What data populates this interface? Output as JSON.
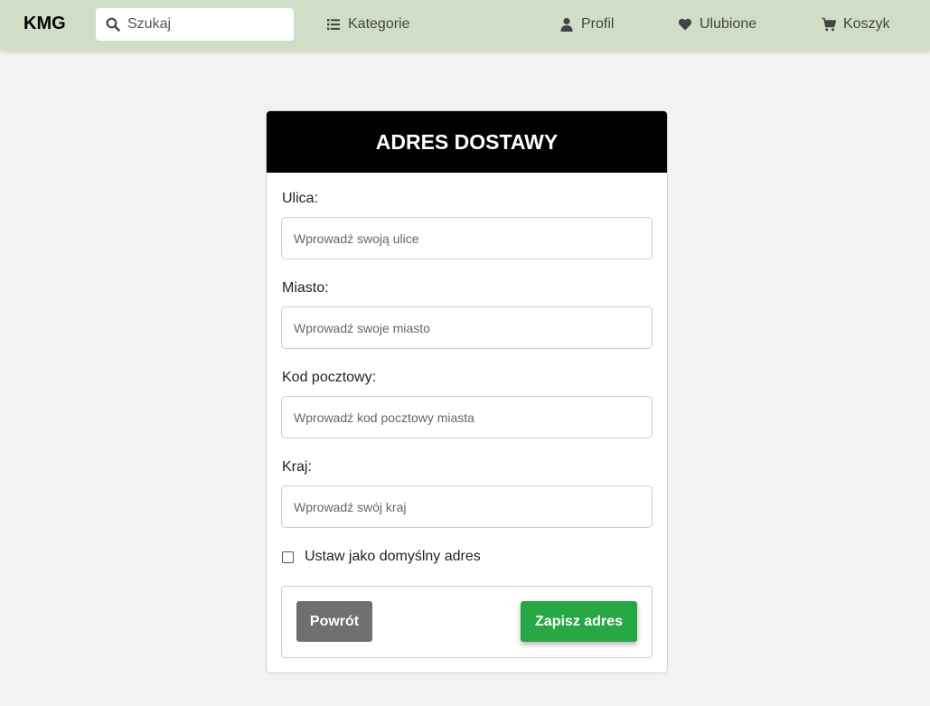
{
  "navbar": {
    "brand": "KMG",
    "search_placeholder": "Szukaj",
    "categories": "Kategorie",
    "profile": "Profil",
    "favorites": "Ulubione",
    "cart": "Koszyk",
    "background": "#d1dec7"
  },
  "form": {
    "title": "ADRES DOSTAWY",
    "street": {
      "label": "Ulica:",
      "placeholder": "Wprowadź swoją ulice",
      "value": ""
    },
    "city": {
      "label": "Miasto:",
      "placeholder": "Wprowadź swoje miasto",
      "value": ""
    },
    "postal": {
      "label": "Kod pocztowy:",
      "placeholder": "Wprowadź kod pocztowy miasta",
      "value": ""
    },
    "country": {
      "label": "Kraj:",
      "placeholder": "Wprowadź swój kraj",
      "value": ""
    },
    "default_checkbox": {
      "label": "Ustaw jako domyślny adres",
      "checked": false
    },
    "back_button": "Powrót",
    "save_button": "Zapisz adres",
    "save_color": "#28a745",
    "back_color": "#6f6f6f"
  }
}
